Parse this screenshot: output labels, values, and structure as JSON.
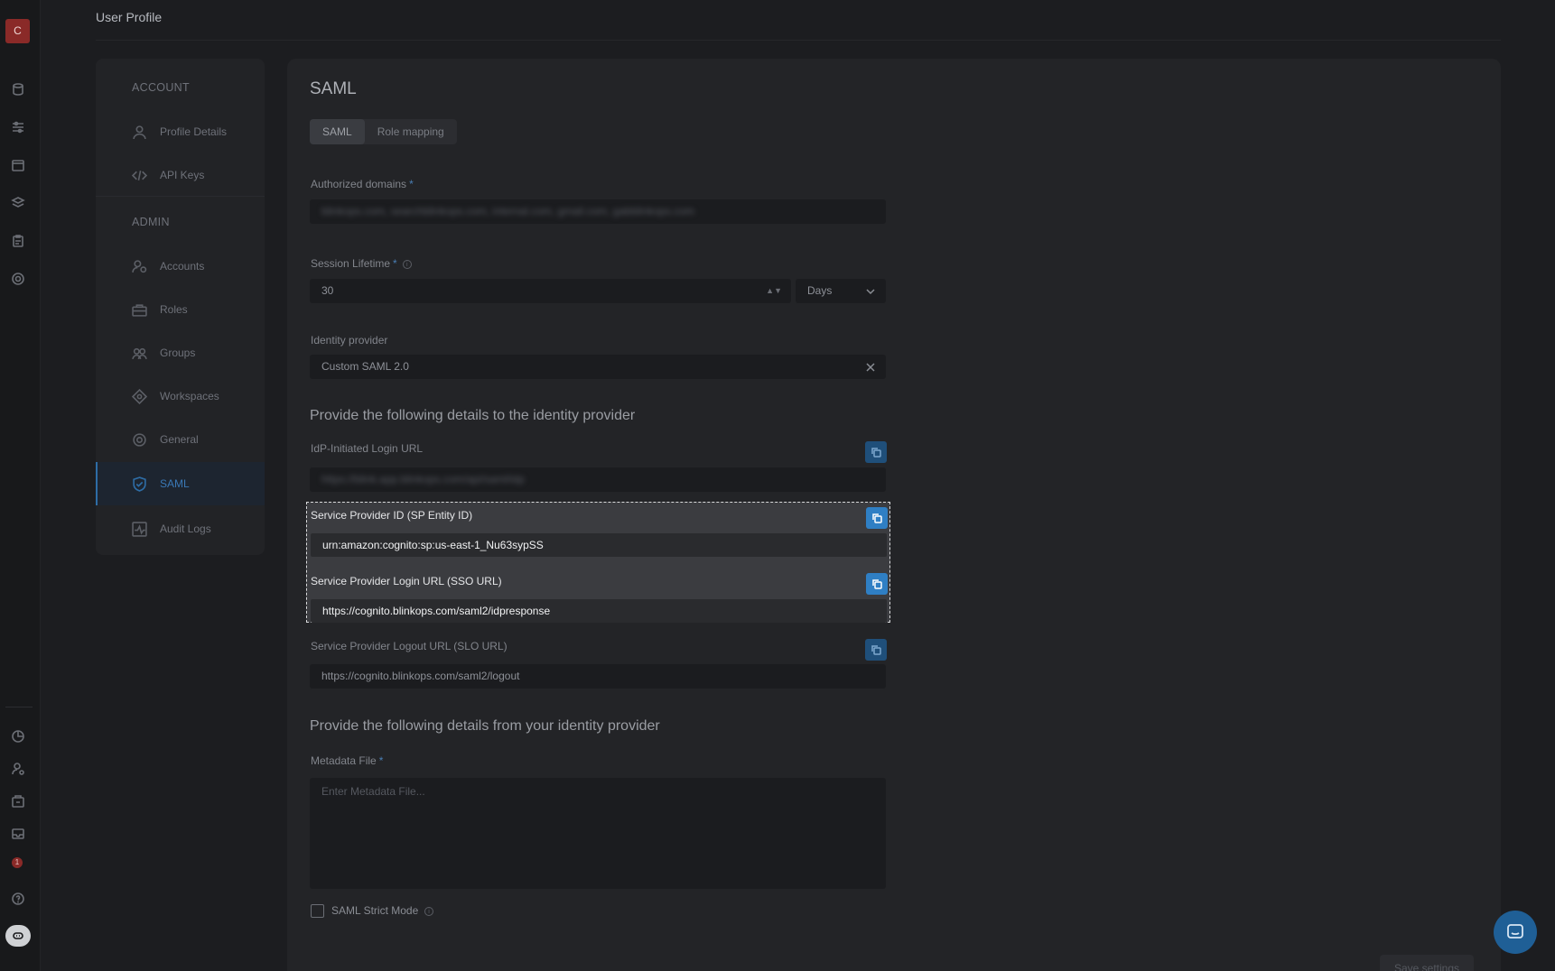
{
  "app": {
    "avatar_letter": "C",
    "notification_count": "1"
  },
  "header": {
    "title": "User Profile"
  },
  "nav": {
    "account_section": "ACCOUNT",
    "admin_section": "ADMIN",
    "items": [
      {
        "label": "Profile Details",
        "icon": "user-icon"
      },
      {
        "label": "API Keys",
        "icon": "code-icon"
      },
      {
        "label": "Accounts",
        "icon": "users-icon"
      },
      {
        "label": "Roles",
        "icon": "briefcase-icon"
      },
      {
        "label": "Groups",
        "icon": "group-icon"
      },
      {
        "label": "Workspaces",
        "icon": "diamond-icon"
      },
      {
        "label": "General",
        "icon": "gear-icon"
      },
      {
        "label": "SAML",
        "icon": "shield-icon"
      },
      {
        "label": "Audit Logs",
        "icon": "activity-icon"
      }
    ],
    "active": "SAML"
  },
  "main": {
    "title": "SAML",
    "tabs": [
      {
        "label": "SAML"
      },
      {
        "label": "Role mapping"
      }
    ],
    "authorized_domains": {
      "label": "Authorized domains",
      "required": "*",
      "value": "blinkops.com, searchblinkops.com, internal.com, gmail.com, gabblinkops.com"
    },
    "session_lifetime": {
      "label": "Session Lifetime",
      "required": "*",
      "value": "30",
      "unit": "Days"
    },
    "identity_provider": {
      "label": "Identity provider",
      "value": "Custom SAML 2.0"
    },
    "provide_to_heading": "Provide the following details to the identity provider",
    "idp_login_url": {
      "label": "IdP-Initiated Login URL",
      "value": "https://blink.app.blinkops.com/api/saml/idp"
    },
    "sp_entity_id": {
      "label": "Service Provider ID (SP Entity ID)",
      "value": "urn:amazon:cognito:sp:us-east-1_Nu63sypSS"
    },
    "sp_login_url": {
      "label": "Service Provider Login URL (SSO URL)",
      "value": "https://cognito.blinkops.com/saml2/idpresponse"
    },
    "sp_logout_url": {
      "label": "Service Provider Logout URL (SLO URL)",
      "value": "https://cognito.blinkops.com/saml2/logout"
    },
    "provide_from_heading": "Provide the following details from your identity provider",
    "metadata_file": {
      "label": "Metadata File",
      "required": "*",
      "placeholder": "Enter Metadata File..."
    },
    "strict_mode": {
      "label": "SAML Strict Mode"
    },
    "save_label": "Save settings"
  }
}
